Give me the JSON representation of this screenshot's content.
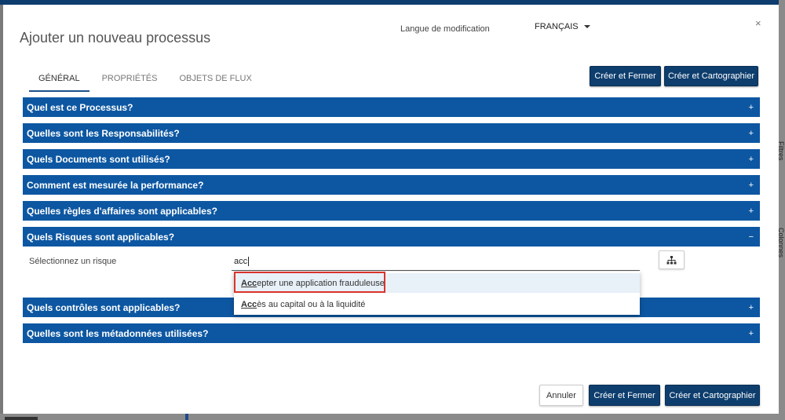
{
  "modal": {
    "title": "Ajouter un nouveau processus",
    "language_label": "Langue de modification",
    "language_value": "FRANÇAIS",
    "close_symbol": "×"
  },
  "tabs": [
    {
      "label": "GÉNÉRAL",
      "active": true
    },
    {
      "label": "PROPRIÉTÉS",
      "active": false
    },
    {
      "label": "OBJETS DE FLUX",
      "active": false
    }
  ],
  "buttons": {
    "create_close": "Créer et Fermer",
    "create_map": "Créer et Cartographier",
    "cancel": "Annuler"
  },
  "sections": [
    {
      "title": "Quel est ce Processus?",
      "sign": "+"
    },
    {
      "title": "Quelles sont les Responsabilités?",
      "sign": "+"
    },
    {
      "title": "Quels Documents sont utilisés?",
      "sign": "+"
    },
    {
      "title": "Comment est mesurée la performance?",
      "sign": "+"
    },
    {
      "title": "Quelles règles d'affaires sont applicables?",
      "sign": "+"
    },
    {
      "title": "Quels Risques sont applicables?",
      "sign": "−"
    },
    {
      "title": "Quels contrôles sont applicables?",
      "sign": "+"
    },
    {
      "title": "Quelles sont les métadonnées utilisées?",
      "sign": "+"
    }
  ],
  "risk": {
    "label": "Sélectionnez un risque",
    "input_value": "acc",
    "suggestions": [
      {
        "match": "Acc",
        "rest": "epter une application frauduleuse",
        "highlighted": true
      },
      {
        "match": "Acc",
        "rest": "ès au capital ou à la liquidité",
        "highlighted": false
      }
    ]
  },
  "background": {
    "side_label_1": "Filtres",
    "side_label_2": "Colonnes"
  },
  "colors": {
    "section_bar": "#0d57a2",
    "dark_button": "#0e3e6e",
    "highlight_box": "#d9342b"
  },
  "icons": {
    "hierarchy": "sitemap-icon",
    "language_caret": "caret-down-icon"
  }
}
